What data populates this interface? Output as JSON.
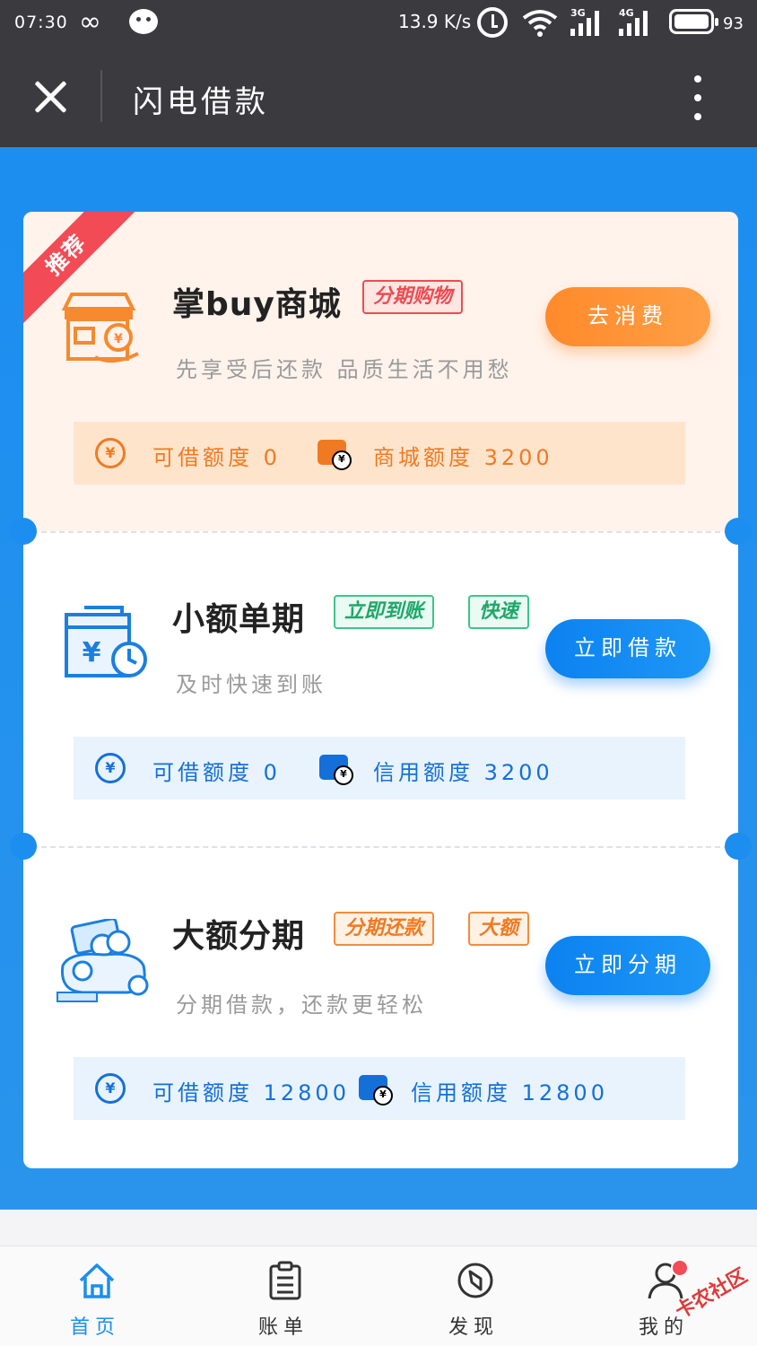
{
  "status_bar": {
    "time": "07:30",
    "speed": "13.9 K/s",
    "battery": "93",
    "net1": "3G",
    "net2": "4G"
  },
  "titlebar": {
    "title": "闪电借款"
  },
  "products": [
    {
      "badge": "推荐",
      "title": "掌buy商城",
      "tags": [
        "分期购物"
      ],
      "subtitle": "先享受后还款 品质生活不用愁",
      "button": "去消费",
      "quota1_label": "可借额度 0",
      "quota2_label": "商城额度 3200"
    },
    {
      "title": "小额单期",
      "tags": [
        "立即到账",
        "快速"
      ],
      "subtitle": "及时快速到账",
      "button": "立即借款",
      "quota1_label": "可借额度 0",
      "quota2_label": "信用额度 3200"
    },
    {
      "title": "大额分期",
      "tags": [
        "分期还款",
        "大额"
      ],
      "subtitle": "分期借款，还款更轻松",
      "button": "立即分期",
      "quota1_label": "可借额度 12800",
      "quota2_label": "信用额度 12800"
    }
  ],
  "bottom_nav": [
    {
      "label": "首页",
      "icon": "home-icon",
      "active": true
    },
    {
      "label": "账单",
      "icon": "bill-icon"
    },
    {
      "label": "发现",
      "icon": "compass-icon"
    },
    {
      "label": "我的",
      "icon": "user-icon"
    }
  ],
  "watermark": "卡农社区",
  "colors": {
    "primary": "#1b8ef0",
    "orange": "#ff8a2b",
    "red": "#f24b55",
    "green": "#1fa76a"
  }
}
